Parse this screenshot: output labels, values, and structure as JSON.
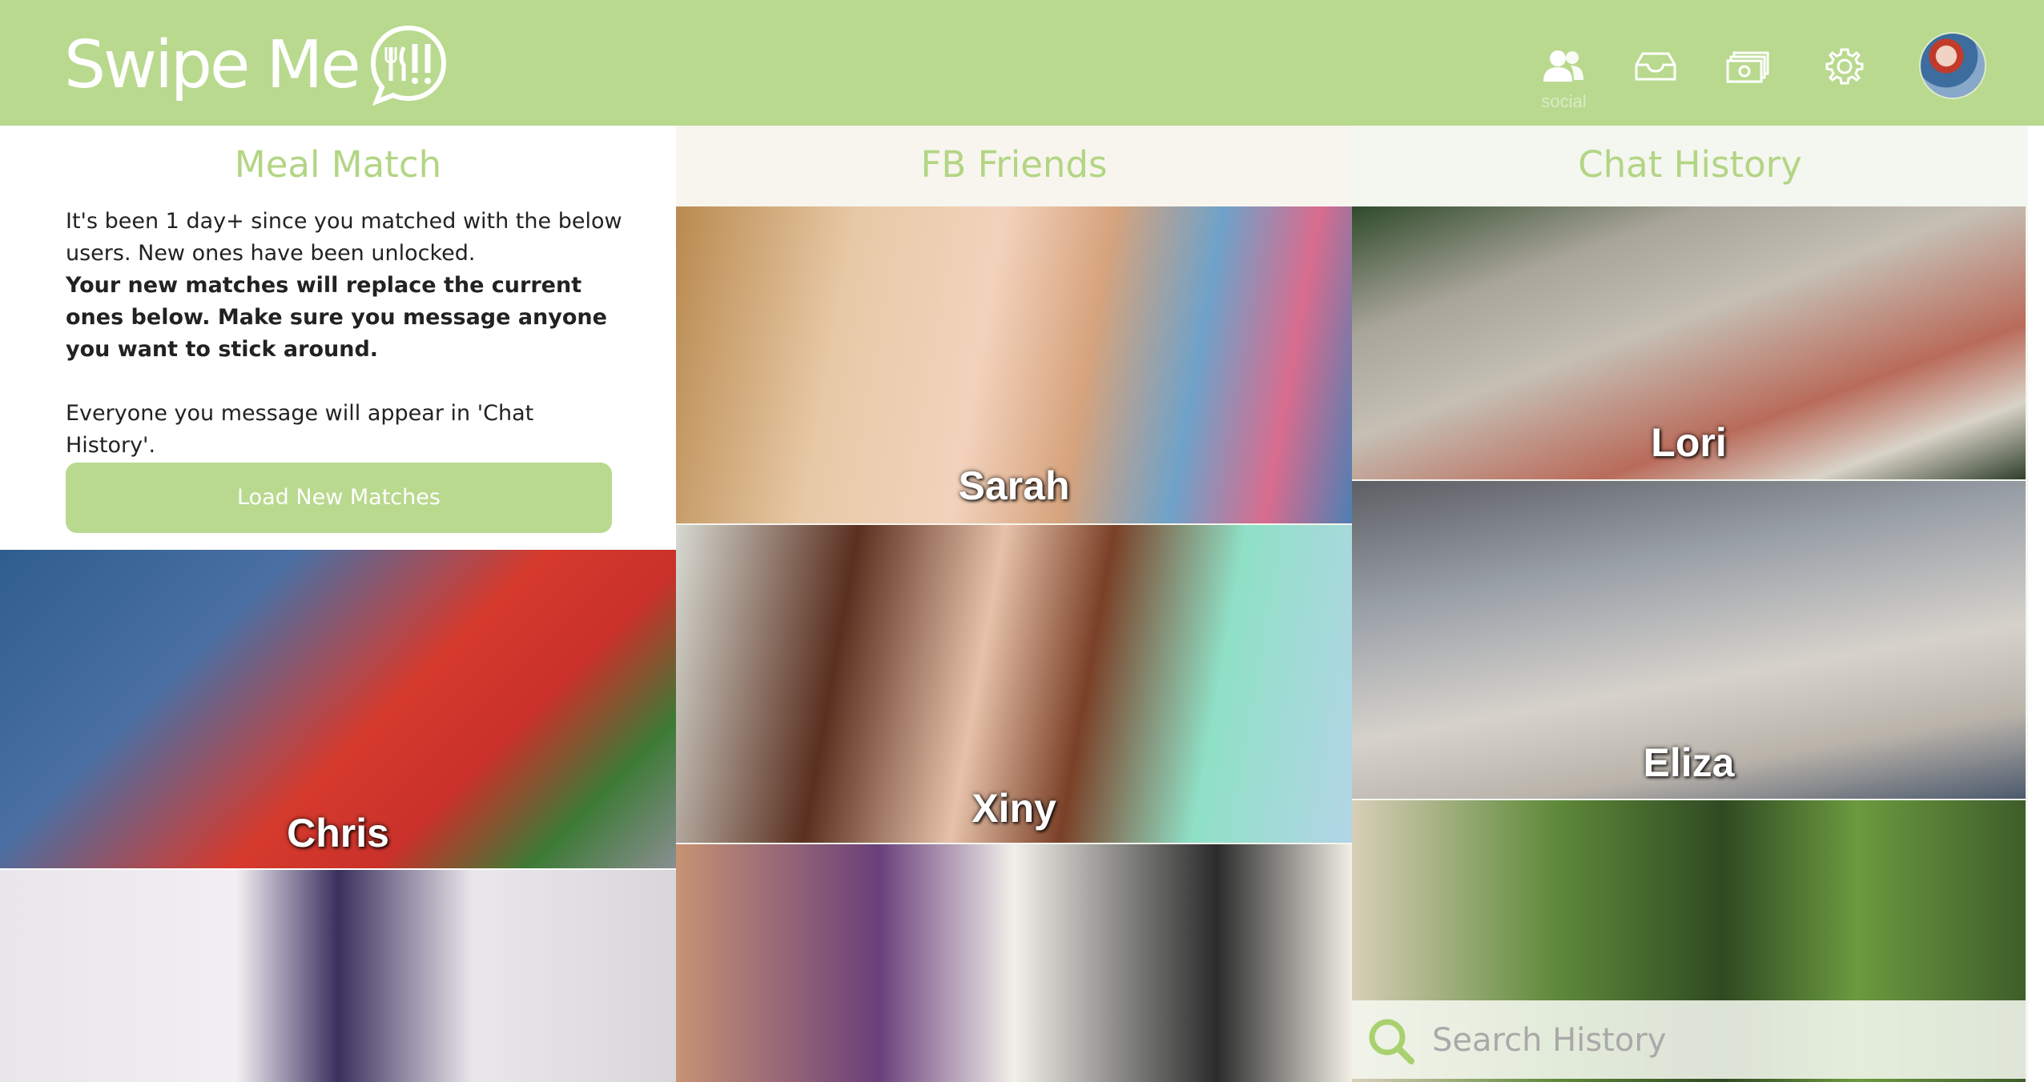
{
  "app": {
    "logo_text": "Swipe Me"
  },
  "nav": {
    "social_label": "social",
    "items": [
      "social-icon",
      "inbox-icon",
      "money-icon",
      "gear-icon",
      "avatar"
    ]
  },
  "meal_match": {
    "title": "Meal Match",
    "intro_line1": "It's been 1 day+ since you matched with the below users. New ones have been unlocked.",
    "intro_bold": "Your new matches will replace the current ones below. Make sure you message anyone you want to stick around.",
    "intro_line3": "Everyone you message will appear in 'Chat History'.",
    "load_button": "Load New Matches",
    "cards": [
      "Chris",
      ""
    ]
  },
  "fb_friends": {
    "title": "FB Friends",
    "cards": [
      "Sarah",
      "Xiny",
      ""
    ]
  },
  "chat_history": {
    "title": "Chat History",
    "cards": [
      "Lori",
      "Eliza",
      ""
    ],
    "search_placeholder": "Search History"
  },
  "colors": {
    "brand_green": "#b9d98f",
    "title_green": "#b3d584",
    "text_dark": "#222222"
  }
}
